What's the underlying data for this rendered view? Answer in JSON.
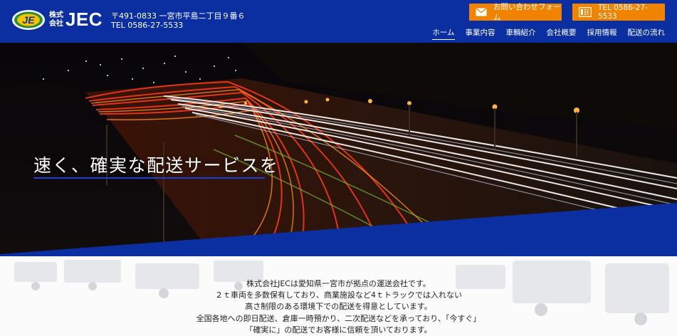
{
  "header": {
    "logo_mark_text": "JE",
    "company_prefix": "株式会社",
    "company_name": "JEC",
    "address": "〒491-0833 一宮市平島二丁目９番６",
    "tel": "TEL 0586-27-5533",
    "contact_button": "お問い合わせフォーム",
    "tel_button": "TEL 0586-27-5533"
  },
  "nav": {
    "items": [
      "ホーム",
      "事業内容",
      "車輌紹介",
      "会社概要",
      "採用情報",
      "配送の流れ"
    ]
  },
  "hero": {
    "headline": "速く、確実な配送サービスを"
  },
  "intro": {
    "lines": [
      "株式会社JECは愛知県一宮市が拠点の運送会社です。",
      "２ｔ車両を多数保有しており、商業施設など4ｔトラックでは入れない",
      "高さ制限のある環境下での配送を得意としています。",
      "全国各地への即日配送、倉庫一時預かり、二次配送などを承っており、「今すぐ」",
      "「確実に」の配送でお客様に信頼を頂いております。"
    ]
  },
  "colors": {
    "header_bg": "#0b2fa0",
    "cta_orange": "#f08300",
    "accent_blue": "#1c3fd6"
  },
  "icons": {
    "mail": "envelope-icon",
    "tel": "phone-icon"
  }
}
